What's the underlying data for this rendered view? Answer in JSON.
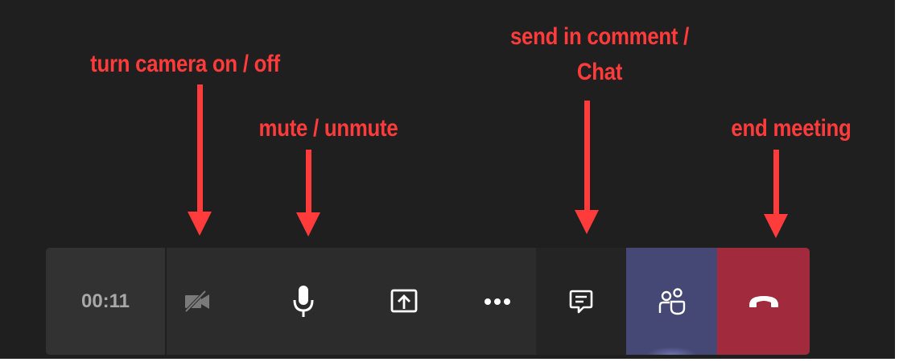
{
  "annotations": {
    "camera": "turn camera on / off",
    "mute": "mute / unmute",
    "chat_line1": "send in comment /",
    "chat_line2": "Chat",
    "end": "end meeting"
  },
  "toolbar": {
    "timer": "00:11",
    "buttons": [
      {
        "name": "camera-toggle",
        "icon": "camera-off-icon"
      },
      {
        "name": "mic-toggle",
        "icon": "microphone-icon"
      },
      {
        "name": "share-screen",
        "icon": "share-tray-icon"
      },
      {
        "name": "more-actions",
        "icon": "more-dots-icon"
      },
      {
        "name": "chat",
        "icon": "chat-icon"
      },
      {
        "name": "participants",
        "icon": "people-icon"
      },
      {
        "name": "hang-up",
        "icon": "phone-end-icon"
      }
    ]
  },
  "colors": {
    "annotation": "#ff3b3b",
    "background": "#1f1f1f",
    "toolbar": "#2d2c2c",
    "participants_active": "#454774",
    "end_call": "#a12b3d"
  }
}
